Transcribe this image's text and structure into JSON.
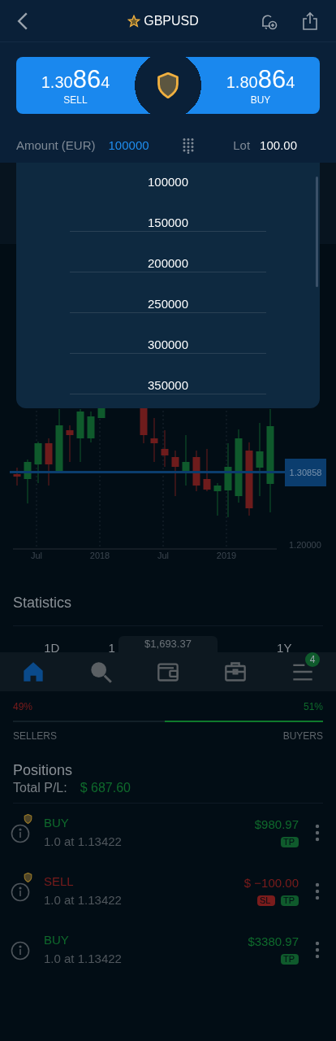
{
  "header": {
    "title": "GBPUSD",
    "favorite": true
  },
  "quotes": [
    {
      "kind": "sell",
      "start": "1.30",
      "pips": "86",
      "end": "4",
      "label": "SELL"
    },
    {
      "kind": "buy",
      "start": "1.80",
      "pips": "86",
      "end": "4",
      "label": "BUY"
    }
  ],
  "amount": {
    "label": "Amount (EUR)",
    "value": "100000"
  },
  "lot": {
    "label": "Lot",
    "value": "100.00"
  },
  "amount_options": [
    "100000",
    "150000",
    "200000",
    "250000",
    "300000",
    "350000"
  ],
  "chart": {
    "price_tag": "1.30858",
    "y_label": "1.20000",
    "x_labels": [
      "Jul",
      "2018",
      "Jul",
      "2019"
    ]
  },
  "statistics": {
    "title": "Statistics",
    "periods": [
      "1D",
      "1",
      "1Y"
    ]
  },
  "balance": "$1,693.37",
  "nav": [
    {
      "kind": "home",
      "selected": true
    },
    {
      "kind": "search",
      "selected": false
    },
    {
      "kind": "wallet",
      "selected": false
    },
    {
      "kind": "briefcase",
      "selected": false
    },
    {
      "kind": "menu",
      "selected": false,
      "badge": "4"
    }
  ],
  "sentiment": {
    "sellers_pct": "49%",
    "buyers_pct": "51%",
    "level": 0.51,
    "sellers_label": "SELLERS",
    "buyers_label": "BUYERS"
  },
  "positions": {
    "title": "Positions",
    "total_label": "Total P/L:",
    "total": "$ 687.60",
    "items": [
      {
        "kind": "buy",
        "side": "BUY",
        "protected": true,
        "detail": "1.0 at 1.13422",
        "pl": "$980.97",
        "tags": [
          {
            "kind": "tp",
            "label": "TP"
          }
        ]
      },
      {
        "kind": "sell",
        "side": "SELL",
        "protected": true,
        "detail": "1.0 at 1.13422",
        "pl": "$ −100.00",
        "tags": [
          {
            "kind": "sl",
            "label": "SL"
          },
          {
            "kind": "tp",
            "label": "TP"
          }
        ]
      },
      {
        "kind": "buy",
        "side": "BUY",
        "protected": false,
        "detail": "1.0 at 1.13422",
        "pl": "$3380.97",
        "tags": [
          {
            "kind": "tp",
            "label": "TP"
          }
        ]
      }
    ]
  }
}
